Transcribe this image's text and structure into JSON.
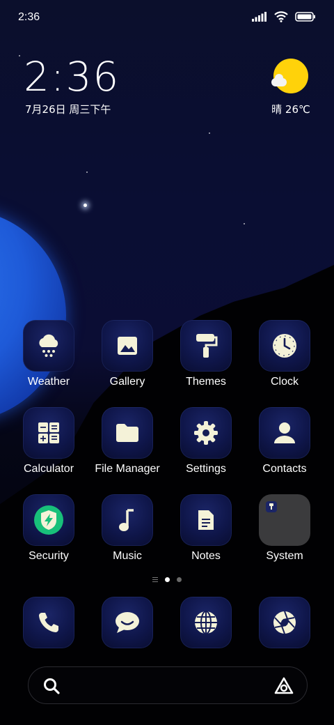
{
  "status_bar": {
    "time": "2:36"
  },
  "clock_widget": {
    "time": "2:36",
    "date": "7月26日 周三下午"
  },
  "weather_widget": {
    "text": "晴 26℃"
  },
  "apps": [
    {
      "label": "Weather",
      "icon": "weather-snow-icon"
    },
    {
      "label": "Gallery",
      "icon": "gallery-icon"
    },
    {
      "label": "Themes",
      "icon": "paint-roller-icon"
    },
    {
      "label": "Clock",
      "icon": "clock-icon"
    },
    {
      "label": "Calculator",
      "icon": "calculator-icon"
    },
    {
      "label": "File Manager",
      "icon": "folder-icon"
    },
    {
      "label": "Settings",
      "icon": "gear-icon"
    },
    {
      "label": "Contacts",
      "icon": "person-icon"
    },
    {
      "label": "Security",
      "icon": "shield-bolt-icon"
    },
    {
      "label": "Music",
      "icon": "music-note-icon"
    },
    {
      "label": "Notes",
      "icon": "note-icon"
    },
    {
      "label": "System",
      "icon": "folder-system-icon"
    }
  ],
  "dock": [
    {
      "icon": "phone-icon"
    },
    {
      "icon": "message-icon"
    },
    {
      "icon": "browser-globe-icon"
    },
    {
      "icon": "camera-shutter-icon"
    }
  ],
  "page_indicator": {
    "pages": 2,
    "active": 1
  },
  "colors": {
    "accent_sun": "#ffd20a",
    "tile": "#0f164a",
    "icon_glyph": "#f4f2d8",
    "security_green": "#18c07a"
  }
}
